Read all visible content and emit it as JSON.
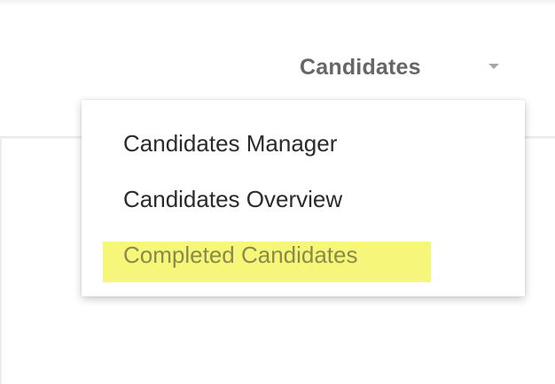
{
  "nav": {
    "label": "Candidates",
    "caret_icon": "chevron-down-icon"
  },
  "dropdown": {
    "items": [
      {
        "label": "Candidates Manager"
      },
      {
        "label": "Candidates Overview"
      },
      {
        "label": "Completed Candidates",
        "highlighted": true
      }
    ],
    "highlight_color": "#f6f77a"
  },
  "colors": {
    "nav_text": "#666666",
    "menu_text": "#2b2b2b",
    "highlighted_text": "#8a8a4a"
  }
}
